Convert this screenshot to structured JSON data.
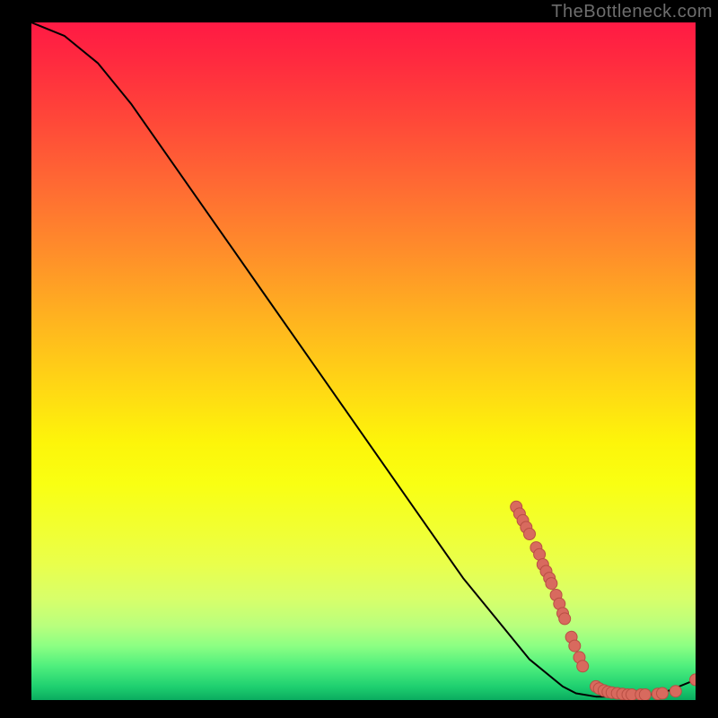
{
  "watermark": "TheBottleneck.com",
  "chart_data": {
    "type": "line",
    "title": "",
    "xlabel": "",
    "ylabel": "",
    "xlim": [
      0,
      100
    ],
    "ylim": [
      0,
      100
    ],
    "grid": false,
    "curve": [
      {
        "x": 0,
        "y": 100
      },
      {
        "x": 5,
        "y": 98
      },
      {
        "x": 10,
        "y": 94
      },
      {
        "x": 15,
        "y": 88
      },
      {
        "x": 20,
        "y": 81
      },
      {
        "x": 25,
        "y": 74
      },
      {
        "x": 30,
        "y": 67
      },
      {
        "x": 35,
        "y": 60
      },
      {
        "x": 40,
        "y": 53
      },
      {
        "x": 45,
        "y": 46
      },
      {
        "x": 50,
        "y": 39
      },
      {
        "x": 55,
        "y": 32
      },
      {
        "x": 60,
        "y": 25
      },
      {
        "x": 65,
        "y": 18
      },
      {
        "x": 70,
        "y": 12
      },
      {
        "x": 75,
        "y": 6
      },
      {
        "x": 80,
        "y": 2
      },
      {
        "x": 82,
        "y": 1
      },
      {
        "x": 85,
        "y": 0.5
      },
      {
        "x": 90,
        "y": 0.5
      },
      {
        "x": 95,
        "y": 1
      },
      {
        "x": 100,
        "y": 3
      }
    ],
    "highlight_points": [
      {
        "x": 73,
        "y": 28.5
      },
      {
        "x": 73.5,
        "y": 27.5
      },
      {
        "x": 74,
        "y": 26.5
      },
      {
        "x": 74.5,
        "y": 25.5
      },
      {
        "x": 75,
        "y": 24.5
      },
      {
        "x": 76,
        "y": 22.5
      },
      {
        "x": 76.5,
        "y": 21.5
      },
      {
        "x": 77,
        "y": 20.0
      },
      {
        "x": 77.5,
        "y": 19.0
      },
      {
        "x": 78,
        "y": 18.0
      },
      {
        "x": 78.3,
        "y": 17.2
      },
      {
        "x": 79,
        "y": 15.5
      },
      {
        "x": 79.5,
        "y": 14.2
      },
      {
        "x": 80,
        "y": 12.8
      },
      {
        "x": 80.3,
        "y": 12.0
      },
      {
        "x": 81.3,
        "y": 9.3
      },
      {
        "x": 81.8,
        "y": 8.0
      },
      {
        "x": 82.5,
        "y": 6.3
      },
      {
        "x": 83,
        "y": 5.0
      },
      {
        "x": 85,
        "y": 2.0
      },
      {
        "x": 85.5,
        "y": 1.7
      },
      {
        "x": 86.2,
        "y": 1.4
      },
      {
        "x": 86.8,
        "y": 1.2
      },
      {
        "x": 87.4,
        "y": 1.1
      },
      {
        "x": 88.2,
        "y": 1.0
      },
      {
        "x": 89,
        "y": 0.9
      },
      {
        "x": 89.8,
        "y": 0.8
      },
      {
        "x": 90.4,
        "y": 0.8
      },
      {
        "x": 91.8,
        "y": 0.8
      },
      {
        "x": 92.4,
        "y": 0.8
      },
      {
        "x": 94.3,
        "y": 0.9
      },
      {
        "x": 95,
        "y": 1.0
      },
      {
        "x": 97,
        "y": 1.3
      },
      {
        "x": 100,
        "y": 3.0
      }
    ],
    "colors": {
      "curve": "#000000",
      "points_fill": "#d86a5e",
      "points_stroke": "#b94f44"
    }
  }
}
